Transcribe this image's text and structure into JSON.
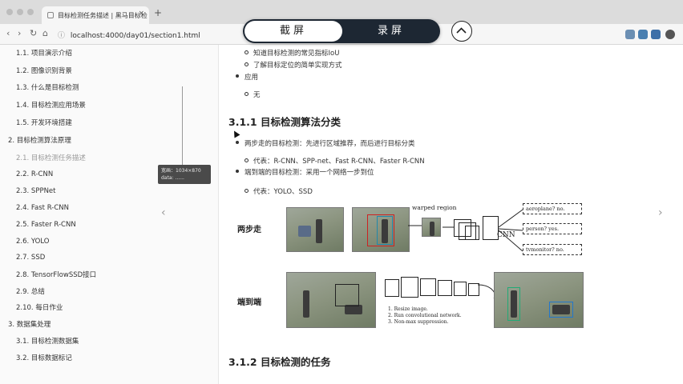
{
  "browser": {
    "tab_title": "目标检测任务描述 | 黑马目标检",
    "tab_close": "×",
    "new_tab": "+",
    "url": "localhost:4000/day01/section1.html",
    "nav_back": "‹",
    "nav_forward": "›",
    "nav_reload": "↻",
    "nav_home": "⌂",
    "lock": "ⓘ"
  },
  "overlay": {
    "screenshot_label": "截屏",
    "record_label": "录屏",
    "collapse_icon": "chevron-up-icon"
  },
  "sidebar": {
    "items": [
      {
        "label": "1.1. 项目演示介绍",
        "active": false
      },
      {
        "label": "1.2. 图像识别背景",
        "active": false
      },
      {
        "label": "1.3. 什么是目标检测",
        "active": false
      },
      {
        "label": "1.4. 目标检测应用场景",
        "active": false
      },
      {
        "label": "1.5. 开发环境搭建",
        "active": false
      },
      {
        "label": "2. 目标检测算法原理",
        "active": false
      },
      {
        "label": "2.1. 目标检测任务描述",
        "active": true
      },
      {
        "label": "2.2. R-CNN",
        "active": false
      },
      {
        "label": "2.3. SPPNet",
        "active": false
      },
      {
        "label": "2.4. Fast R-CNN",
        "active": false
      },
      {
        "label": "2.5. Faster R-CNN",
        "active": false
      },
      {
        "label": "2.6. YOLO",
        "active": false
      },
      {
        "label": "2.7. SSD",
        "active": false
      },
      {
        "label": "2.8. TensorFlowSSD接口",
        "active": false
      },
      {
        "label": "2.9. 总结",
        "active": false
      },
      {
        "label": "2.10. 每日作业",
        "active": false
      },
      {
        "label": "3. 数据集处理",
        "active": false
      },
      {
        "label": "3.1. 目标检测数据集",
        "active": false
      },
      {
        "label": "3.2. 目标数据标记",
        "active": false
      }
    ],
    "tooltip_line1": "宽画：1034×870",
    "tooltip_line2": "data: ......"
  },
  "main": {
    "sub1": "知道目标检测的常见指标IoU",
    "sub2": "了解目标定位的简单实现方式",
    "apply": "应用",
    "none": "无",
    "section_title": "3.1.1 目标检测算法分类",
    "two_stage": "两步走的目标检测：先进行区域推荐，而后进行目标分类",
    "two_stage_rep": "代表：R-CNN、SPP-net、Fast R-CNN、Faster R-CNN",
    "one_stage": "端到端的目标检测：采用一个网络一步到位",
    "one_stage_rep": "代表：YOLO、SSD",
    "fig_two_label": "两步走",
    "fig_one_label": "端到端",
    "warped": "warped region",
    "cnn": "CNN",
    "out1": "aeroplane? no.",
    "out2": "person? yes.",
    "out3": "tvmonitor? no.",
    "step1": "1. Resize image.",
    "step2": "2. Run convolutional network.",
    "step3": "3. Non-max suppression.",
    "next_section": "3.1.2 目标检测的任务",
    "prev_arrow": "‹",
    "next_arrow": "›"
  }
}
